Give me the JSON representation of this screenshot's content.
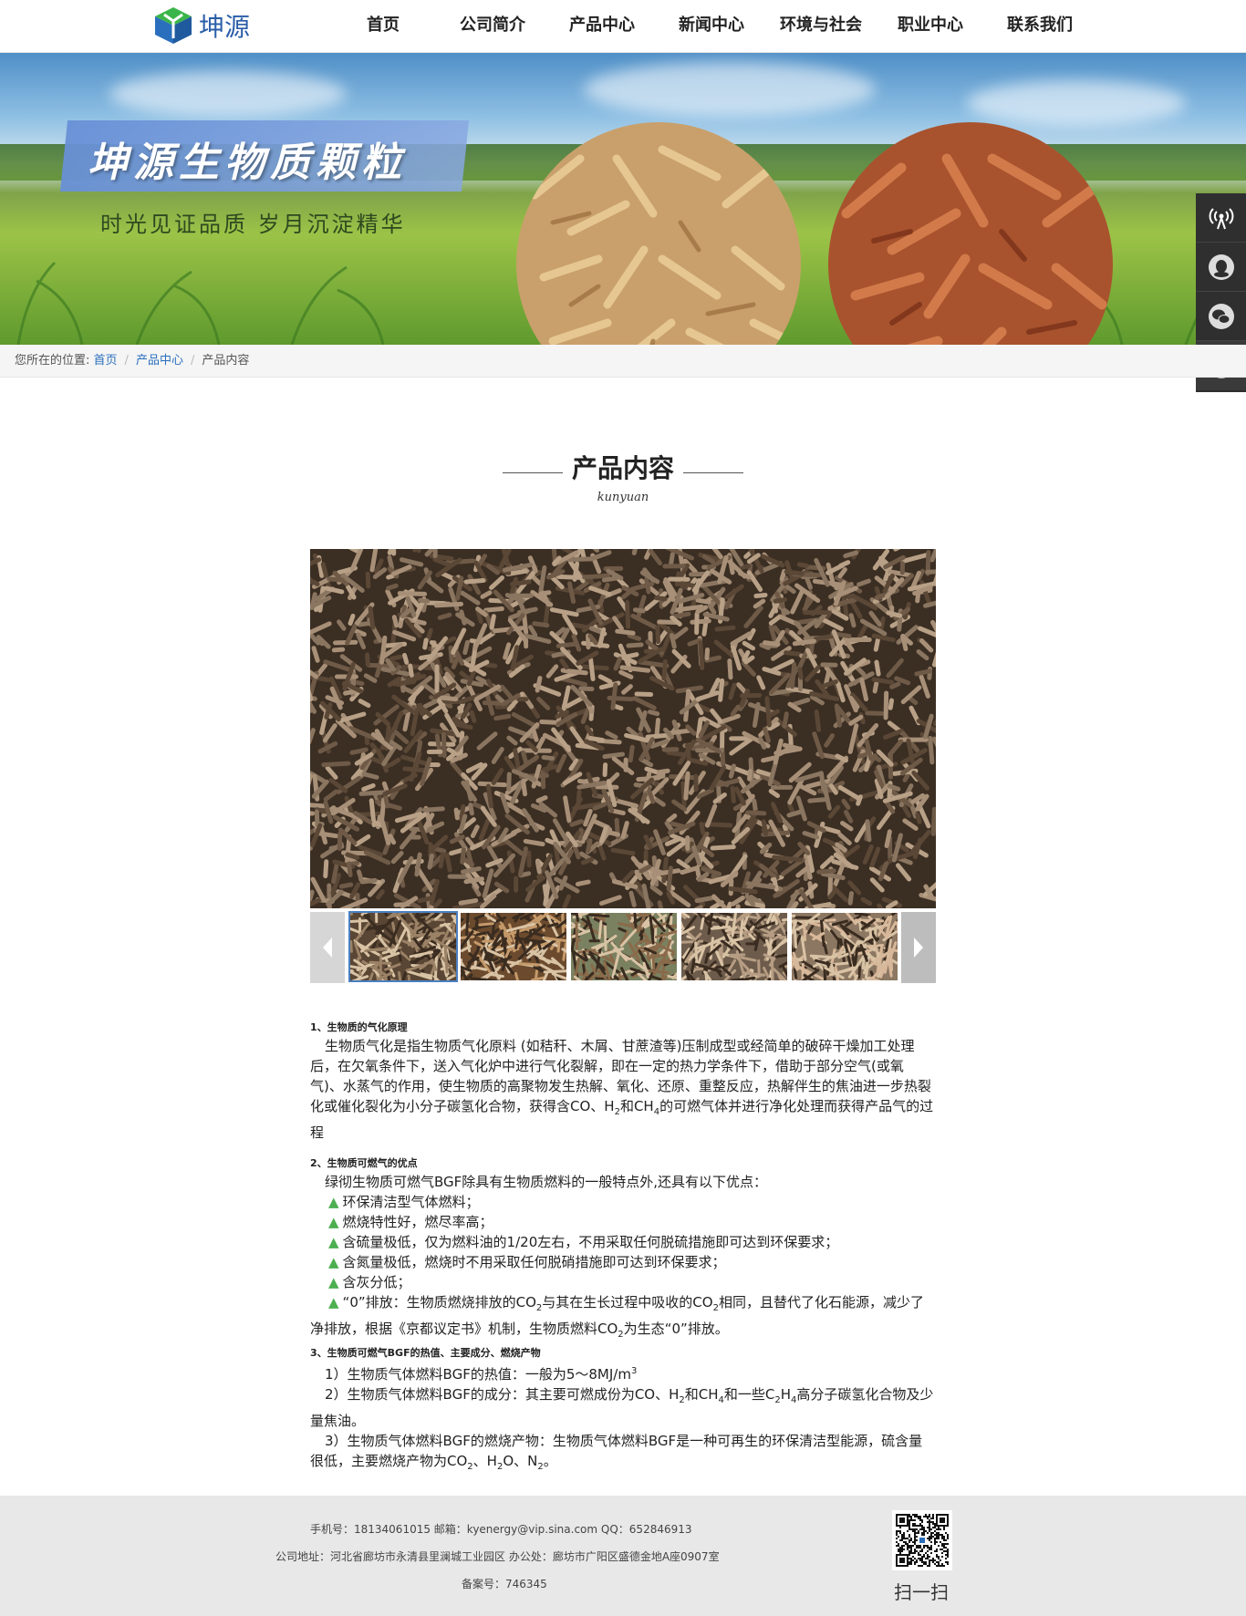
{
  "header": {
    "logo_text": "坤源",
    "nav": [
      "首页",
      "公司简介",
      "产品中心",
      "新闻中心",
      "环境与社会",
      "职业中心",
      "联系我们"
    ]
  },
  "banner": {
    "title": "坤源生物质颗粒",
    "subtitle": "时光见证品质  岁月沉淀精华"
  },
  "side_widget": {
    "icons": [
      "signal-icon",
      "qq-icon",
      "wechat-icon",
      "back-to-top-icon"
    ]
  },
  "breadcrumb": {
    "prefix": "您所在的位置:",
    "items": [
      "首页",
      "产品中心",
      "产品内容"
    ],
    "separator": "/"
  },
  "section": {
    "title": "产品内容",
    "subtitle": "kunyuan"
  },
  "gallery": {
    "thumbnail_count": 5,
    "active_index": 0
  },
  "article": {
    "s1_head": "1、生物质的气化原理",
    "s1_body": "生物质气化是指生物质气化原料 (如秸秆、木屑、甘蔗渣等)压制成型或经简单的破碎干燥加工处理后，在欠氧条件下，送入气化炉中进行气化裂解，即在一定的热力学条件下，借助于部分空气(或氧气)、水蒸气的作用，使生物质的高聚物发生热解、氧化、还原、重整反应，热解伴生的焦油进一步热裂化或催化裂化为小分子碳氢化合物，获得含CO、H",
    "s1_body_mid": "和CH",
    "s1_body_end": "的可燃气体并进行净化处理而获得产品气的过程",
    "s1_sub_a": "2",
    "s1_sub_b": "4",
    "s2_head": "2、生物质可燃气的优点",
    "s2_intro": "绿彻生物质可燃气BGF除具有生物质燃料的一般特点外,还具有以下优点：",
    "bullets": [
      "环保清洁型气体燃料；",
      "燃烧特性好，燃尽率高；",
      "含硫量极低，仅为燃料油的1/20左右，不用采取任何脱硫措施即可达到环保要求；",
      "含氮量极低，燃烧时不用采取任何脱硝措施即可达到环保要求；",
      "含灰分低；"
    ],
    "bullet6_a": "“0”排放：生物质燃烧排放的CO",
    "bullet6_b": "与其在生长过程中吸收的CO",
    "bullet6_c": "相同，且替代了化石能源，减少了净排放，根据《京都议定书》机制，生物质燃料CO",
    "bullet6_d": "为生态“0”排放。",
    "sub2": "2",
    "s3_head": "3、生物质可燃气BGF的热值、主要成分、燃烧产物",
    "s3_p1": "1）生物质气体燃料BGF的热值：一般为5～8MJ/m",
    "s3_p1_sup": "3",
    "s3_p2_a": "2）生物质气体燃料BGF的成分：其主要可燃成份为CO、H",
    "s3_p2_b": "和CH",
    "s3_p2_c": "和一些C",
    "s3_p2_d": "H",
    "s3_p2_e": "高分子碳氢化合物及少量焦油。",
    "sub4": "4",
    "s3_p3_a": "3）生物质气体燃料BGF的燃烧产物：生物质气体燃料BGF是一种可再生的环保清洁型能源，硫含量很低，主要燃烧产物为CO",
    "s3_p3_b": "、H",
    "s3_p3_c": "O、N",
    "s3_p3_d": "。"
  },
  "footer": {
    "line1": "手机号：18134061015    邮箱：kyenergy@vip.sina.com    QQ：652846913",
    "line2": "公司地址：河北省廊坊市永清县里澜城工业园区    办公处：廊坊市广阳区盛德金地A座0907室",
    "line3": "备案号：746345",
    "qr_label": "扫一扫"
  },
  "colors": {
    "link": "#2a6fbd",
    "bullet": "#4caf50",
    "side_widget": "#2f2f2f",
    "footer_bg": "#e8e8e8"
  }
}
